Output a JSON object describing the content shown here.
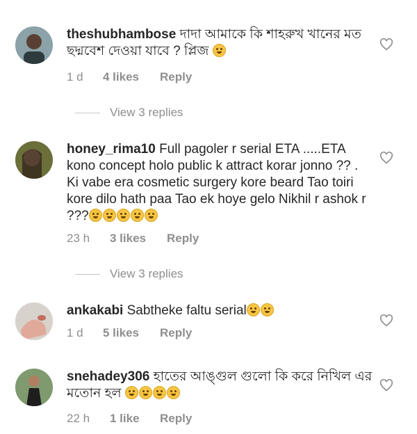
{
  "comments": [
    {
      "username": "theshubhambose",
      "text": "দাদা আমাকে কি শাহরুখ খানের মত ছদ্মবেশ দেওয়া যাবে ? প্লিজ",
      "emojis": [
        "sad-face"
      ],
      "time": "1 d",
      "likes": "4 likes",
      "reply": "Reply",
      "view_replies": "View 3 replies"
    },
    {
      "username": "honey_rima10",
      "text": "Full pagoler r serial ETA .....ETA kono concept holo public k attract korar jonno ?? . Ki vabe era cosmetic surgery kore beard Tao toiri kore dilo hath paa Tao ek hoye gelo Nikhil r ashok r ???",
      "emojis": [
        "laughing-face",
        "laughing-face",
        "laughing-face",
        "laughing-face",
        "laughing-face"
      ],
      "time": "23 h",
      "likes": "3 likes",
      "reply": "Reply",
      "view_replies": "View 3 replies"
    },
    {
      "username": "ankakabi",
      "text": "Sabtheke faltu serial",
      "emojis": [
        "grimace-face",
        "grimace-face"
      ],
      "time": "1 d",
      "likes": "5 likes",
      "reply": "Reply"
    },
    {
      "username": "snehadey306",
      "text": "হাতের আঙ্গুল গুলো কি করে নিখিল এর মতোন হল",
      "emojis": [
        "thinking-face",
        "smirk-face",
        "laughing-face",
        "laughing-face"
      ],
      "time": "22 h",
      "likes": "1 like",
      "reply": "Reply"
    }
  ]
}
